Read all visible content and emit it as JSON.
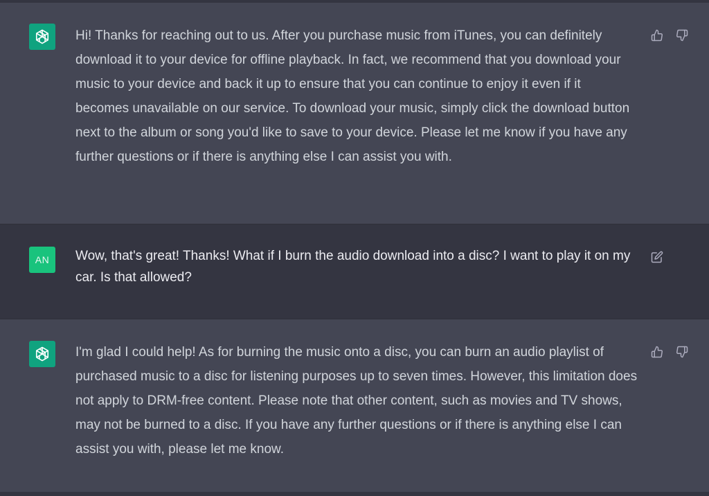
{
  "colors": {
    "assistant_bg": "#444654",
    "user_bg": "#343541",
    "avatar_assistant": "#10a37f",
    "avatar_user": "#19c37d",
    "text": "#d1d5db"
  },
  "conversation": {
    "messages": [
      {
        "role": "assistant",
        "avatar_icon": "openai-logo-icon",
        "text": "Hi! Thanks for reaching out to us. After you purchase music from iTunes, you can definitely download it to your device for offline playback. In fact, we recommend that you download your music to your device and back it up to ensure that you can continue to enjoy it even if it becomes unavailable on our service. To download your music, simply click the download button next to the album or song you'd like to save to your device. Please let me know if you have any further questions or if there is anything else I can assist you with.",
        "actions": [
          "thumbs-up-icon",
          "thumbs-down-icon"
        ]
      },
      {
        "role": "user",
        "avatar_initials": "AN",
        "text": "Wow, that's great! Thanks! What if I burn the audio download into a disc? I want to play it on my car. Is that allowed?",
        "actions": [
          "edit-icon"
        ]
      },
      {
        "role": "assistant",
        "avatar_icon": "openai-logo-icon",
        "text": "I'm glad I could help! As for burning the music onto a disc, you can burn an audio playlist of purchased music to a disc for listening purposes up to seven times. However, this limitation does not apply to DRM-free content. Please note that other content, such as movies and TV shows, may not be burned to a disc. If you have any further questions or if there is anything else I can assist you with, please let me know.",
        "actions": [
          "thumbs-up-icon",
          "thumbs-down-icon"
        ]
      }
    ]
  }
}
